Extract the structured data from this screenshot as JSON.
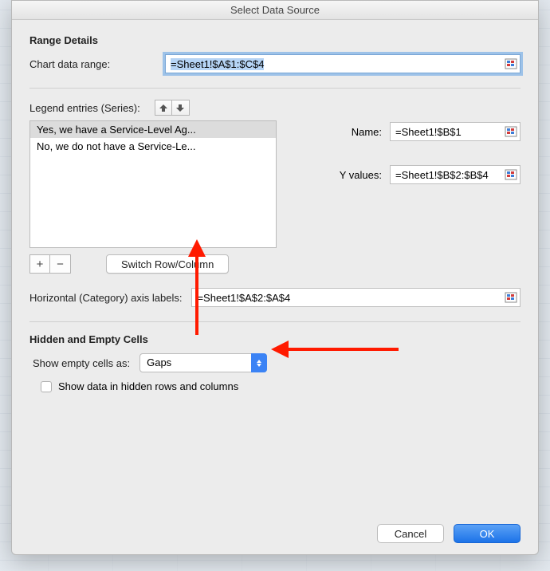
{
  "dialog": {
    "title": "Select Data Source"
  },
  "range_details": {
    "heading": "Range Details",
    "chart_data_range_label": "Chart data range:",
    "chart_data_range_value": "=Sheet1!$A$1:$C$4"
  },
  "legend": {
    "label": "Legend entries (Series):",
    "items": [
      "Yes, we have a Service-Level Ag...",
      "No, we do not have a Service-Le..."
    ],
    "switch_button": "Switch Row/Column",
    "name_label": "Name:",
    "name_value": "=Sheet1!$B$1",
    "yvalues_label": "Y values:",
    "yvalues_value": "=Sheet1!$B$2:$B$4"
  },
  "axis": {
    "label": "Horizontal (Category) axis labels:",
    "value": "=Sheet1!$A$2:$A$4"
  },
  "hidden_empty": {
    "heading": "Hidden and Empty Cells",
    "show_empty_label": "Show empty cells as:",
    "show_empty_value": "Gaps",
    "show_hidden_label": "Show data in hidden rows and columns"
  },
  "buttons": {
    "cancel": "Cancel",
    "ok": "OK"
  },
  "icons": {
    "range_picker": "range-picker-icon",
    "up": "▲",
    "down": "▼",
    "plus": "+",
    "minus": "−"
  }
}
